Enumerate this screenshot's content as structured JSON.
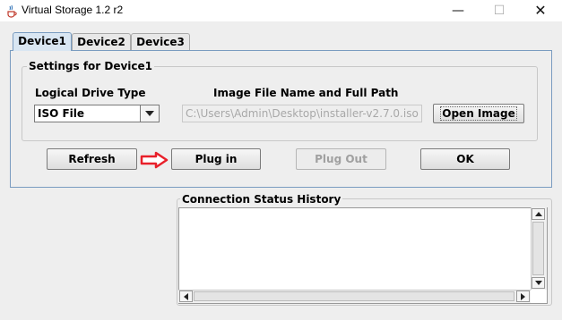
{
  "window": {
    "title": "Virtual Storage 1.2 r2",
    "minimize_glyph": "—",
    "maximize_glyph": "☐",
    "close_glyph": "✕"
  },
  "tabs": [
    {
      "label": "Device1",
      "active": true
    },
    {
      "label": "Device2",
      "active": false
    },
    {
      "label": "Device3",
      "active": false
    }
  ],
  "settings": {
    "group_title": "Settings for Device1",
    "drive_type_label": "Logical Drive Type",
    "drive_type_value": "ISO File",
    "image_path_label": "Image File Name and Full Path",
    "image_path_value": "C:\\Users\\Admin\\Desktop\\installer-v2.7.0.iso",
    "open_image_label": "Open Image"
  },
  "actions": {
    "refresh_label": "Refresh",
    "plugin_label": "Plug in",
    "plugout_label": "Plug Out",
    "ok_label": "OK"
  },
  "status": {
    "title": "Connection Status History",
    "log": ""
  },
  "colors": {
    "annotation_arrow": "#e8202a",
    "active_tab_border": "#7a9cc0"
  }
}
